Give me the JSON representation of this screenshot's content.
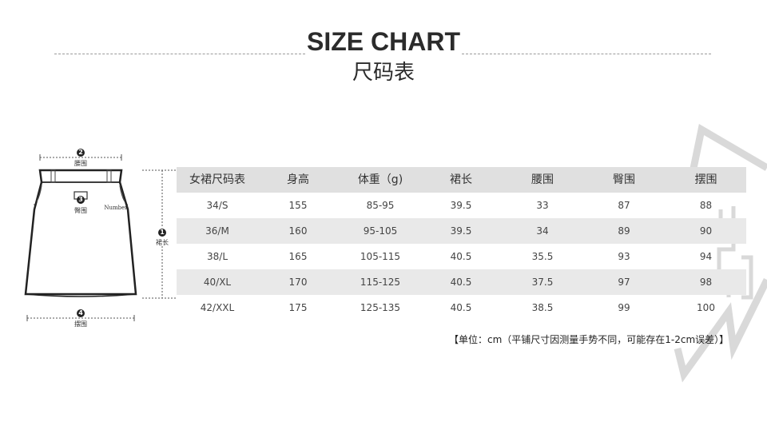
{
  "title_en": "SIZE CHART",
  "title_cn": "尺码表",
  "diagram": {
    "marker1": "1",
    "label1": "裙长",
    "marker2": "2",
    "label2": "腰围",
    "marker3": "3",
    "label3": "臀围",
    "marker4": "4",
    "label4": "摆围",
    "brand_tag": "Number"
  },
  "table": {
    "headers": [
      "女裙尺码表",
      "身高",
      "体重（g)",
      "裙长",
      "腰围",
      "臀围",
      "摆围"
    ],
    "rows": [
      [
        "34/S",
        "155",
        "85-95",
        "39.5",
        "33",
        "87",
        "88"
      ],
      [
        "36/M",
        "160",
        "95-105",
        "39.5",
        "34",
        "89",
        "90"
      ],
      [
        "38/L",
        "165",
        "105-115",
        "40.5",
        "35.5",
        "93",
        "94"
      ],
      [
        "40/XL",
        "170",
        "115-125",
        "40.5",
        "37.5",
        "97",
        "98"
      ],
      [
        "42/XXL",
        "175",
        "125-135",
        "40.5",
        "38.5",
        "99",
        "100"
      ]
    ]
  },
  "note": "【单位：cm（平铺尺寸因测量手势不同，可能存在1-2cm误差）】"
}
